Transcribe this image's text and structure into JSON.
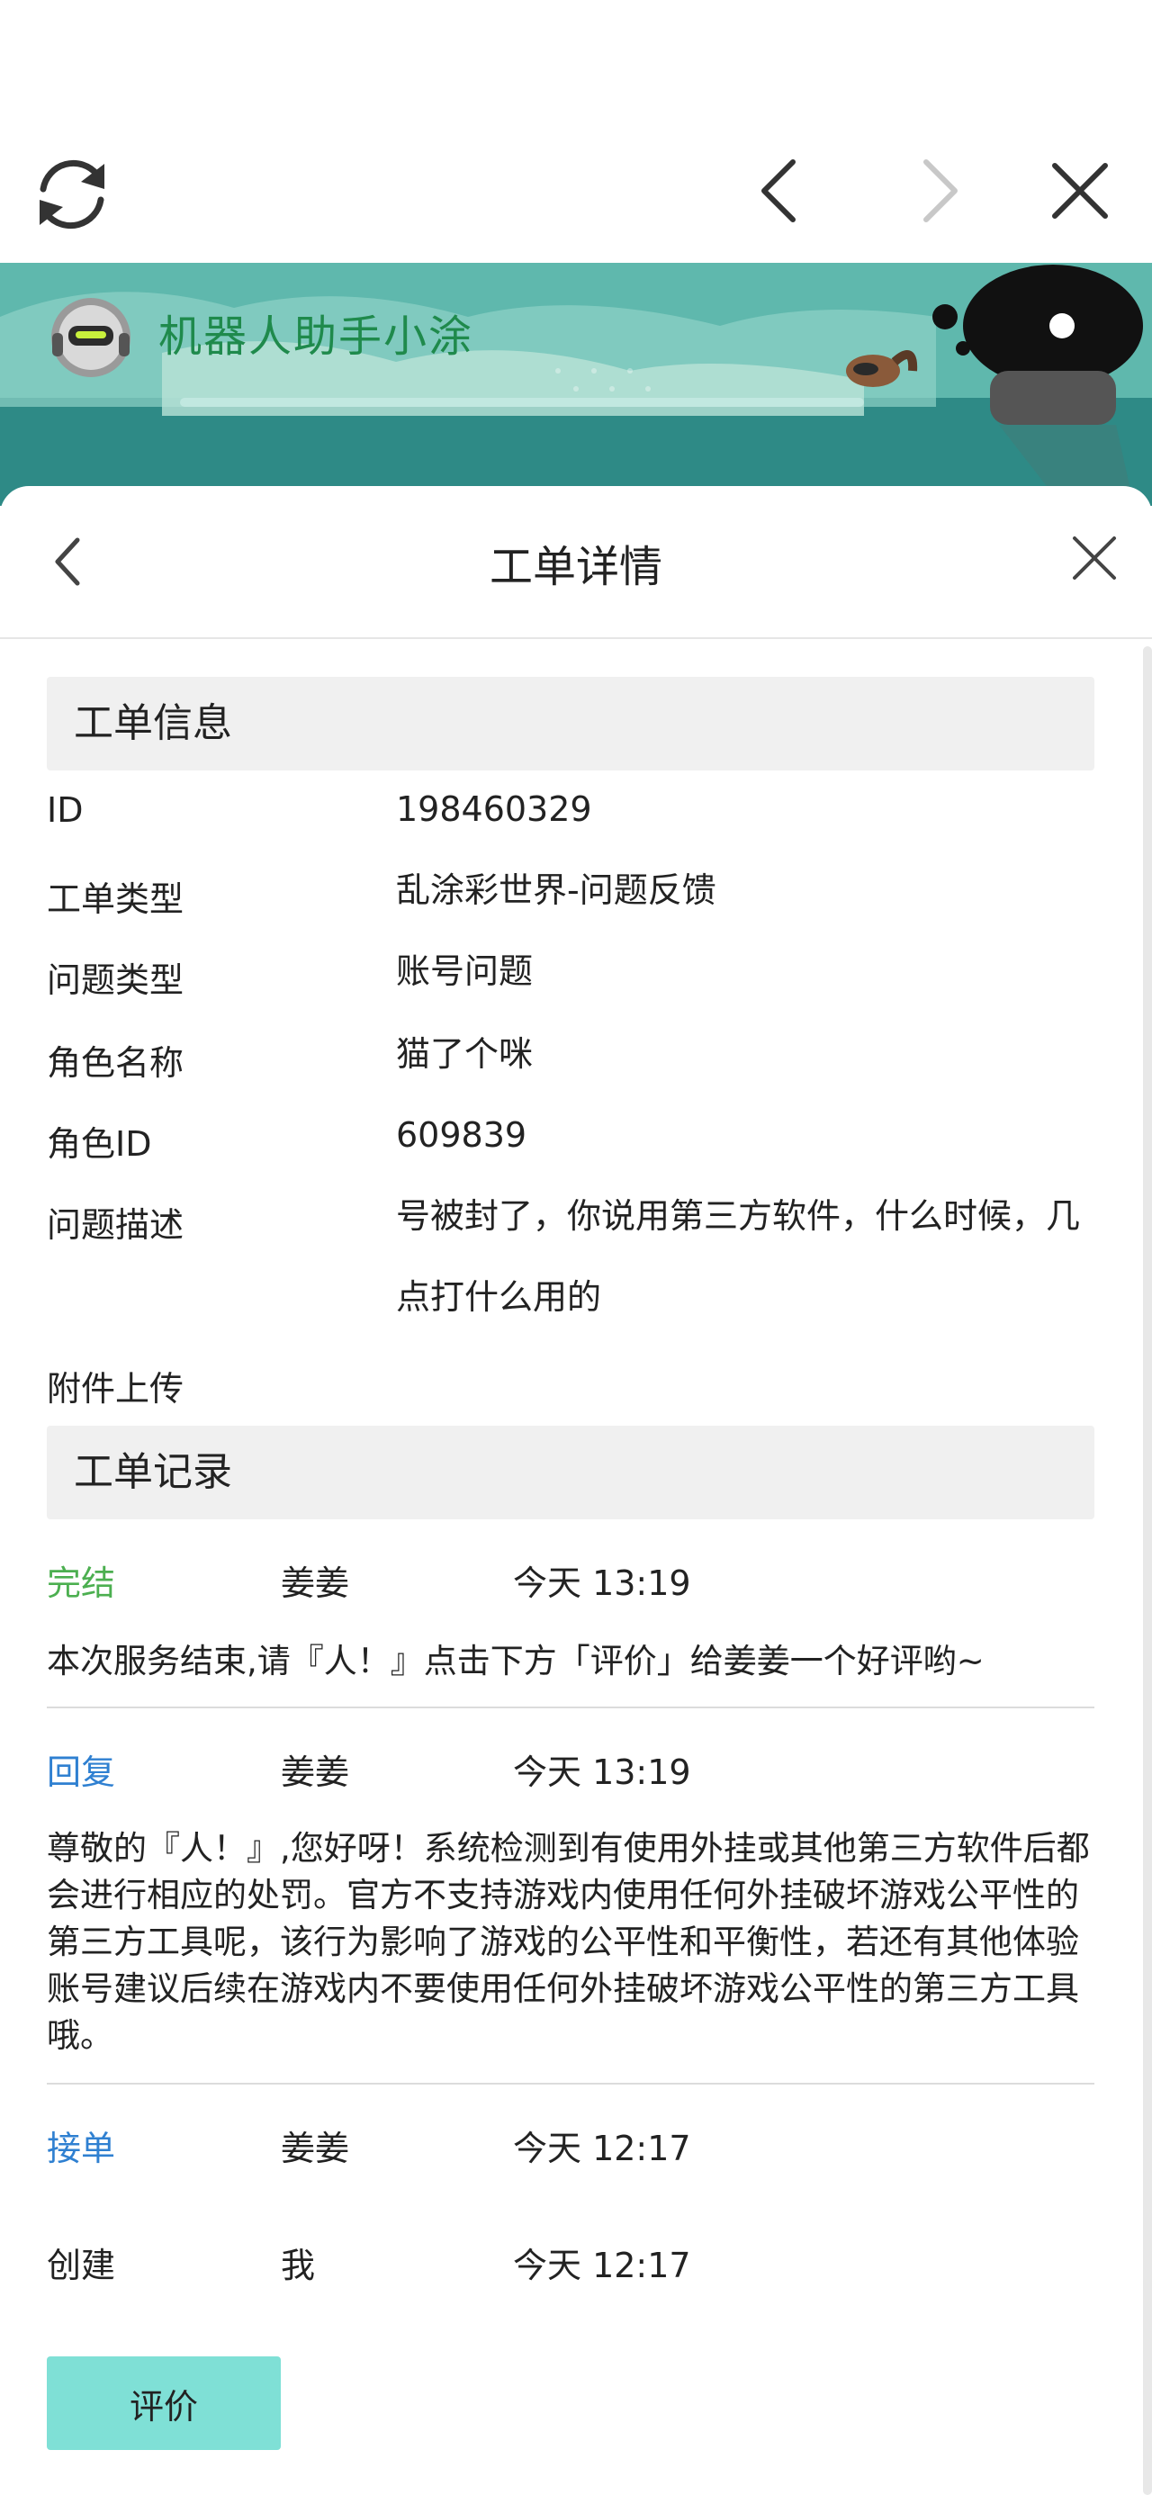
{
  "browser": {
    "icons": {
      "refresh": "refresh-icon",
      "back": "chevron-left-icon",
      "forward": "chevron-right-icon",
      "close": "close-icon"
    }
  },
  "banner": {
    "title": "机器人助手小涂"
  },
  "sheet": {
    "title": "工单详情"
  },
  "ticket_info": {
    "header": "工单信息",
    "rows": [
      {
        "label": "ID",
        "value": "198460329"
      },
      {
        "label": "工单类型",
        "value": "乱涂彩世界-问题反馈"
      },
      {
        "label": "问题类型",
        "value": "账号问题"
      },
      {
        "label": "角色名称",
        "value": "猫了个咪"
      },
      {
        "label": "角色ID",
        "value": "609839"
      },
      {
        "label": "问题描述",
        "value": "号被封了，你说用第三方软件，什么时候，几点打什么用的"
      },
      {
        "label": "附件上传",
        "value": ""
      }
    ]
  },
  "records": {
    "header": "工单记录",
    "items": [
      {
        "status": "完结",
        "agent": "姜姜",
        "time": "今天 13:19",
        "text": "本次服务结束,请『人！』点击下方「评价」给姜姜一个好评哟~"
      },
      {
        "status": "回复",
        "agent": "姜姜",
        "time": "今天 13:19",
        "text": "尊敬的『人！』,您好呀！系统检测到有使用外挂或其他第三方软件后都会进行相应的处罚。官方不支持游戏内使用任何外挂破坏游戏公平性的第三方工具呢，该行为影响了游戏的公平性和平衡性，若还有其他体验账号建议后续在游戏内不要使用任何外挂破坏游戏公平性的第三方工具哦。"
      },
      {
        "status": "接单",
        "agent": "姜姜",
        "time": "今天 12:17"
      },
      {
        "status": "创建",
        "agent": "我",
        "time": "今天 12:17"
      }
    ]
  },
  "actions": {
    "rate_label": "评价"
  },
  "colors": {
    "accent_teal": "#7fe0d6",
    "status_done": "#4caf50",
    "status_blue": "#2f80d1",
    "banner_teal": "#2e8a86"
  }
}
